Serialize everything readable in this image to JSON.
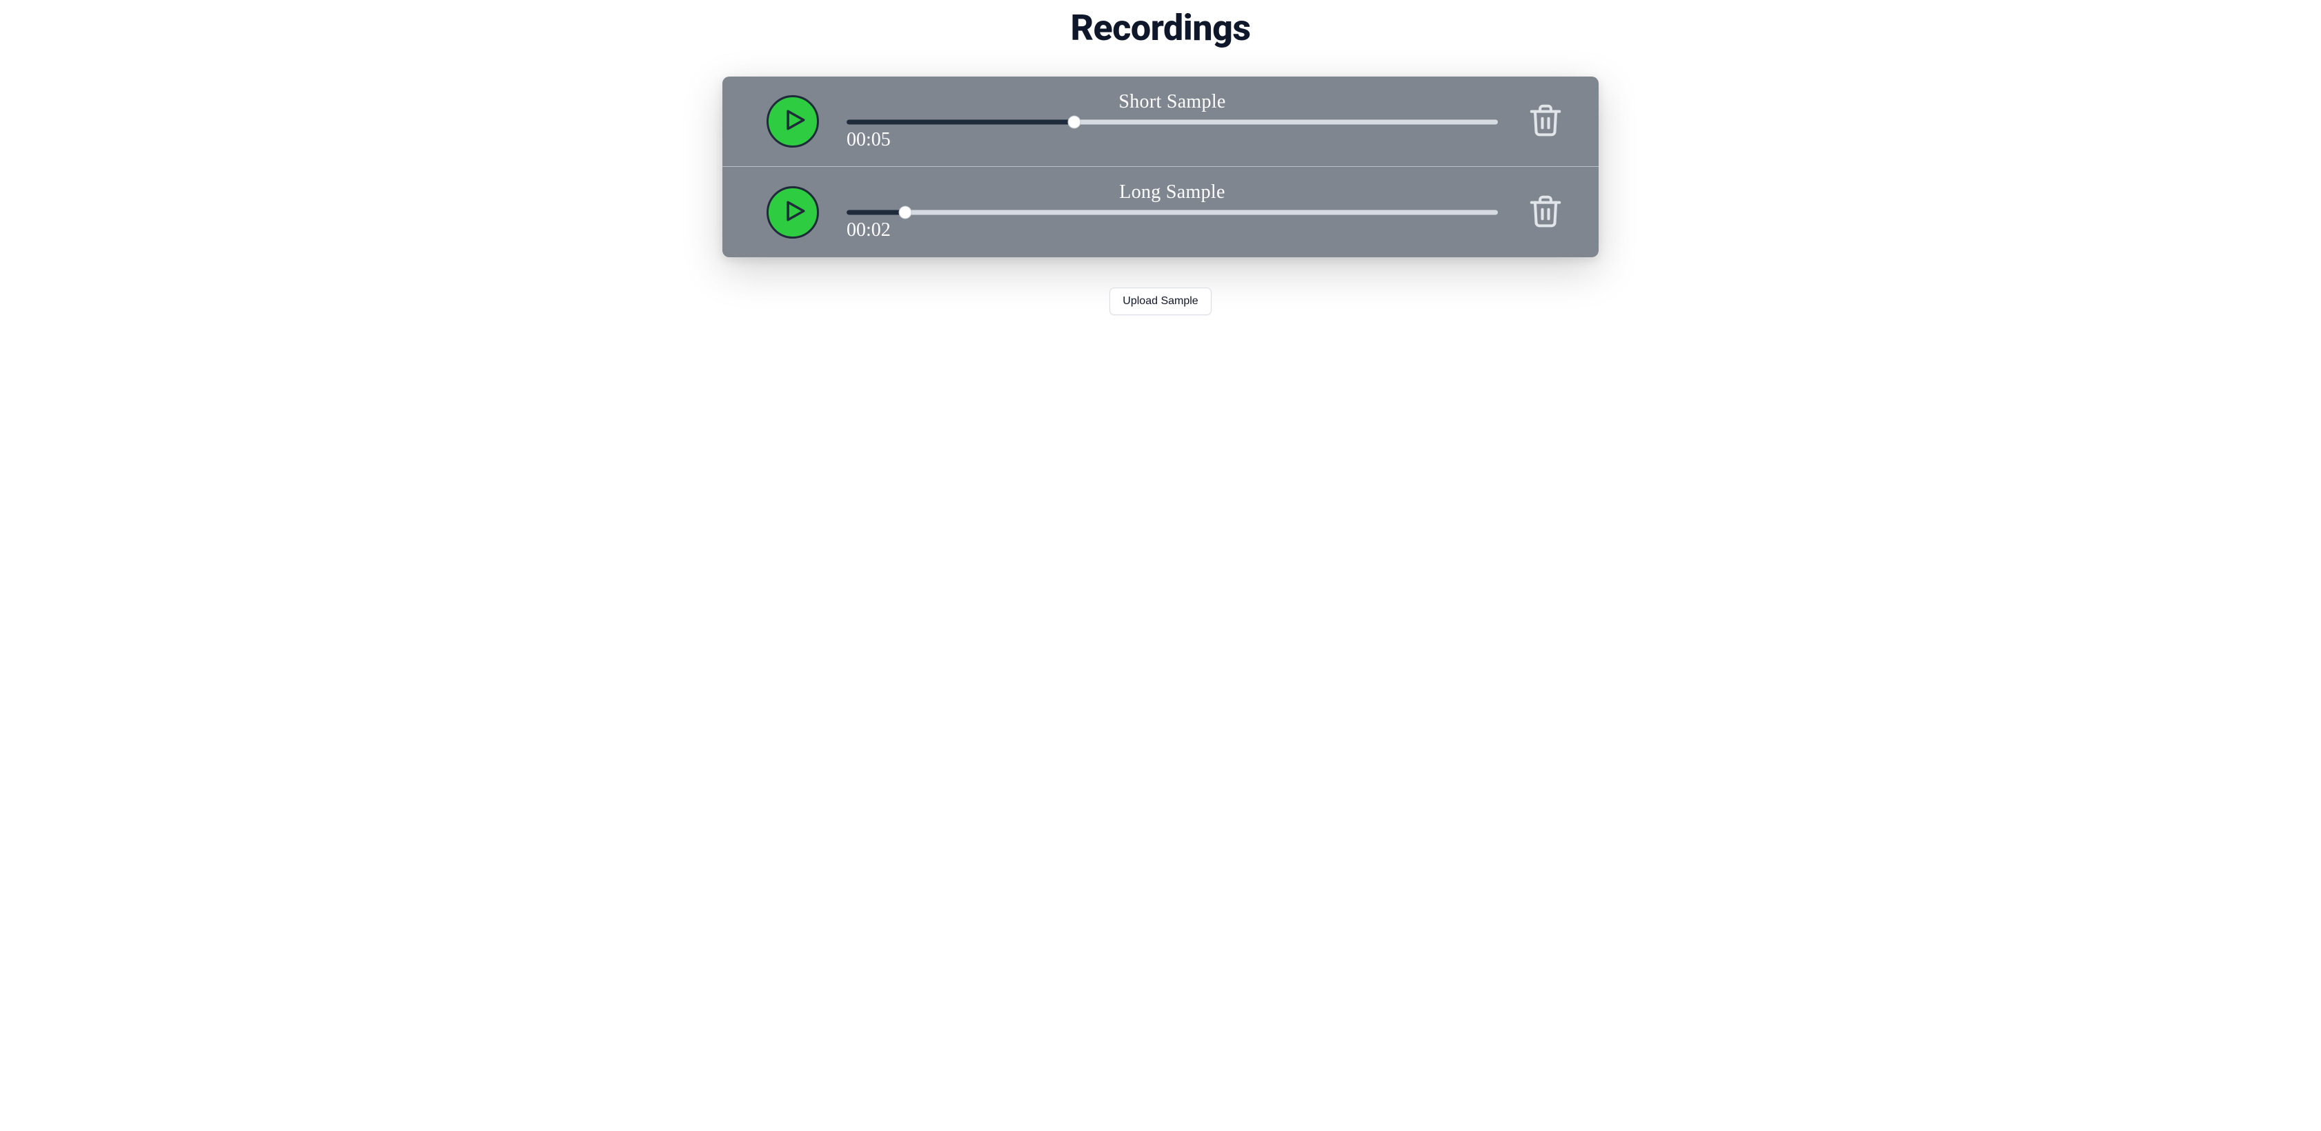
{
  "title": "Recordings",
  "upload_label": "Upload Sample",
  "tracks": [
    {
      "name": "Short Sample",
      "time": "00:05",
      "progress_pct": 35
    },
    {
      "name": "Long Sample",
      "time": "00:02",
      "progress_pct": 9
    }
  ]
}
